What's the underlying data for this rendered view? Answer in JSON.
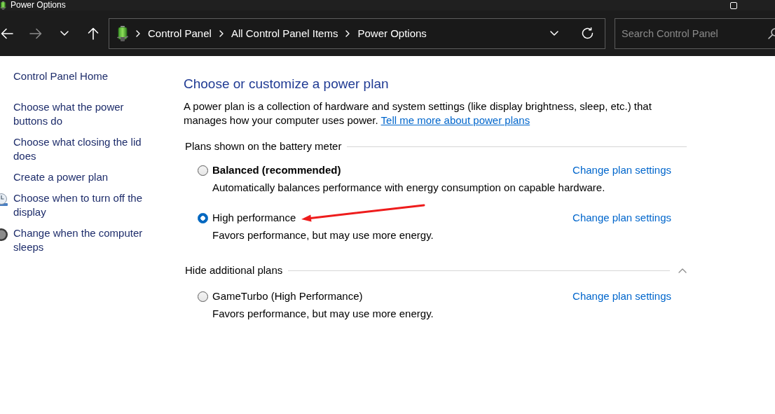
{
  "window": {
    "title": "Power Options"
  },
  "navigation": {
    "buttons": [
      {
        "kind": "back",
        "disabled": false
      },
      {
        "kind": "forward",
        "disabled": true
      },
      {
        "kind": "recent",
        "disabled": false
      },
      {
        "kind": "up",
        "disabled": false
      }
    ],
    "address_bar": {
      "breadcrumbs": [
        "Control Panel",
        "All Control Panel Items",
        "Power Options"
      ]
    },
    "search": {
      "placeholder": "Search Control Panel"
    }
  },
  "sidebar": {
    "home": "Control Panel Home",
    "tasks": [
      {
        "label": "Choose what the power buttons do",
        "kind": "plain"
      },
      {
        "label": "Choose what closing the lid does",
        "kind": "plain"
      },
      {
        "label": "Create a power plan",
        "kind": "plain"
      },
      {
        "label": "Choose when to turn off the display",
        "kind": "monitor"
      },
      {
        "label": "Change when the computer sleeps",
        "kind": "orb"
      }
    ]
  },
  "main": {
    "title": "Choose or customize a power plan",
    "description": "A power plan is a collection of hardware and system settings (like display brightness, sleep, etc.) that manages how your computer uses power.",
    "link": "Tell me more about power plans",
    "groups": [
      {
        "heading": "Plans shown on the battery meter",
        "plans": [
          {
            "name": "Balanced (recommended)",
            "emphasized": true,
            "selected": false,
            "annotated": false,
            "description": "Automatically balances performance with energy consumption on capable hardware.",
            "link": "Change plan settings"
          },
          {
            "name": "High performance",
            "emphasized": false,
            "selected": true,
            "annotated": true,
            "description": "Favors performance, but may use more energy.",
            "link": "Change plan settings"
          }
        ]
      },
      {
        "heading": "Hide additional plans",
        "expanded": true,
        "plans": [
          {
            "name": "GameTurbo (High Performance)",
            "emphasized": false,
            "selected": false,
            "annotated": false,
            "description": "Favors performance, but may use more energy.",
            "link": "Change plan settings"
          }
        ]
      }
    ]
  }
}
